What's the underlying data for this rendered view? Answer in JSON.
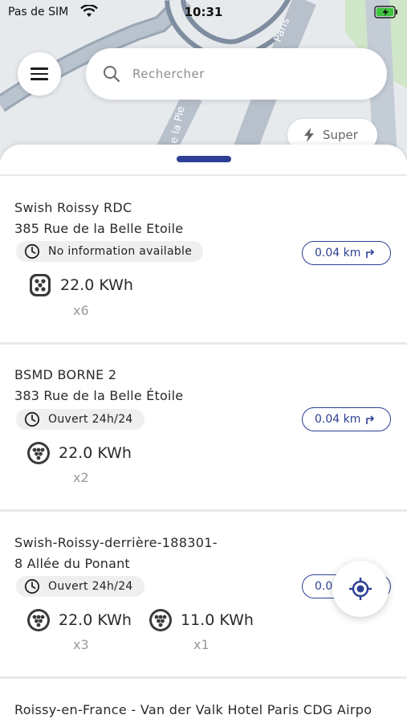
{
  "status_bar": {
    "carrier": "Pas de SIM",
    "time": "10:31"
  },
  "map": {
    "street_label_1": "Paris",
    "street_label_2": "e la Pie"
  },
  "search": {
    "placeholder": "Rechercher"
  },
  "filter_chip": {
    "label": "Super"
  },
  "colors": {
    "accent": "#2d3f95",
    "badge_bg": "#efefef",
    "battery": "#3ec43e"
  },
  "stations": [
    {
      "name": "Swish Roissy RDC",
      "address": "385 Rue de la Belle Etoile",
      "hours": "No information available",
      "distance": "0.04 km",
      "connectors": [
        {
          "icon": "type2-plug-icon",
          "power": "22.0 KWh",
          "count": "x6"
        }
      ]
    },
    {
      "name": "BSMD BORNE 2",
      "address": "383 Rue de la Belle Étoile",
      "hours": "Ouvert 24h/24",
      "distance": "0.04 km",
      "connectors": [
        {
          "icon": "type2-plug-icon",
          "power": "22.0 KWh",
          "count": "x2"
        }
      ]
    },
    {
      "name": "Swish-Roissy-derrière-188301-",
      "address": "8 Allée du Ponant",
      "hours": "Ouvert 24h/24",
      "distance": "0.0",
      "connectors": [
        {
          "icon": "type2-plug-icon",
          "power": "22.0 KWh",
          "count": "x3"
        },
        {
          "icon": "type2-plug-icon",
          "power": "11.0 KWh",
          "count": "x1"
        }
      ]
    },
    {
      "name": "Roissy-en-France - Van der Valk Hotel Paris CDG Airpo"
    }
  ]
}
